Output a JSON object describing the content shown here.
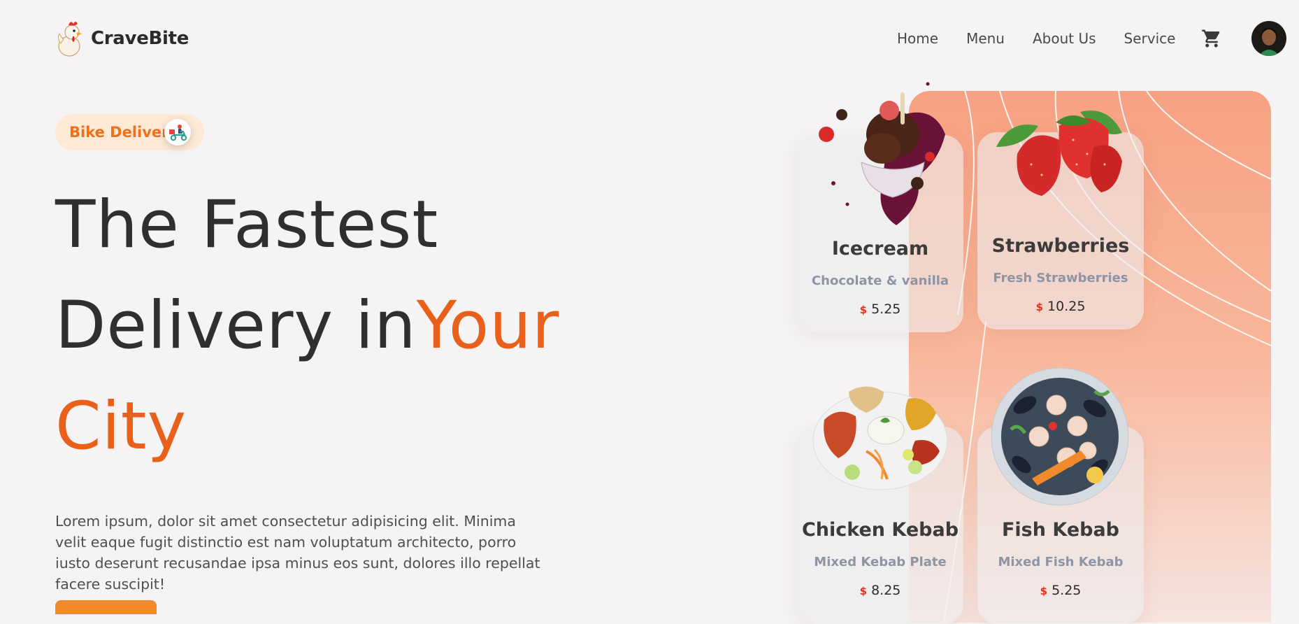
{
  "brand": {
    "name": "CraveBite",
    "logo_icon": "chicken-mascot-icon"
  },
  "nav": {
    "items": [
      {
        "label": "Home"
      },
      {
        "label": "Menu"
      },
      {
        "label": "About Us"
      },
      {
        "label": "Service"
      }
    ],
    "cart_icon": "cart-icon",
    "avatar_icon": "user-avatar"
  },
  "hero": {
    "badge": {
      "label": "Bike Delivery",
      "icon": "scooter-delivery-icon"
    },
    "headline": {
      "line1": "The Fastest",
      "line2_plain": "Delivery in",
      "line2_accent": "Your",
      "line3_accent": "City"
    },
    "description": "Lorem ipsum, dolor sit amet consectetur adipisicing elit. Minima velit eaque fugit distinctio est nam voluptatum architecto, porro iusto deserunt recusandae ipsa minus eos sunt, dolores illo repellat facere suscipit!",
    "colors": {
      "accent": "#e8601a",
      "badge_bg": "#fde9d6",
      "panel": "#f7a182"
    }
  },
  "menu_cards": [
    {
      "title": "Icecream",
      "subtitle": "Chocolate & vanilla",
      "currency": "$",
      "price": "5.25",
      "image": "icecream-image"
    },
    {
      "title": "Strawberries",
      "subtitle": "Fresh Strawberries",
      "currency": "$",
      "price": "10.25",
      "image": "strawberries-image"
    },
    {
      "title": "Chicken Kebab",
      "subtitle": "Mixed Kebab Plate",
      "currency": "$",
      "price": "8.25",
      "image": "chicken-kebab-image"
    },
    {
      "title": "Fish Kebab",
      "subtitle": "Mixed Fish Kebab",
      "currency": "$",
      "price": "5.25",
      "image": "fish-kebab-image"
    }
  ]
}
